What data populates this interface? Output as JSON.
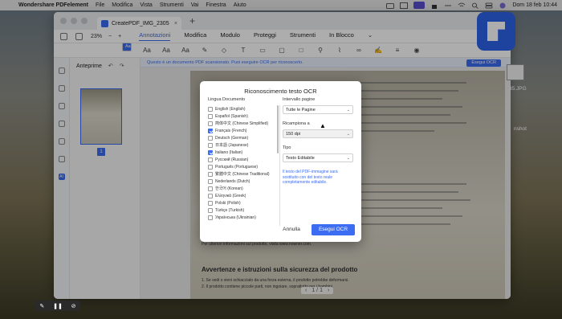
{
  "menubar": {
    "app_name": "Wondershare PDFelement",
    "items": [
      "File",
      "Modifica",
      "Vista",
      "Strumenti",
      "Vai",
      "Finestra",
      "Aiuto"
    ],
    "clock": "Dom 18 feb  10:44"
  },
  "window": {
    "tab_title": "CreatePDF_IMG_2305",
    "zoom": "23%",
    "tabs": [
      "Annotazioni",
      "Modifica",
      "Modulo",
      "Proteggi",
      "Strumenti",
      "In Blocco"
    ],
    "active_tab": "Annotazioni",
    "tab_more": "⌄",
    "tool_labels": [
      "Aa",
      "Aa",
      "Aa",
      "Aa"
    ]
  },
  "sidebar": {
    "panel_title": "Anteprime",
    "page_badge": "1"
  },
  "infobar": {
    "text": "Questo è un documento PDF scansionato. Puoi eseguire OCR per riconoscerlo.",
    "button": "Esegui OCR"
  },
  "document": {
    "heading": "Avvertenze e istruzioni sulla sicurezza del prodotto",
    "lines": [
      "rapidamente. Si prega di scaricare in modo sicuro, seguendo il link per il download.",
      "Per ulteriori informazioni sul prodotto, visita www.nowner.com.",
      "1. Se vedi o vieni schiacciato da una forza esterna, il prodotto potrebbe deformarsi.",
      "2. Il prodotto contiene piccole parti, non ingoiare, soprattutto per i bambini."
    ],
    "pager": "1 / 1"
  },
  "dialog": {
    "title": "Riconoscimento testo OCR",
    "languages_label": "Lingua Documento",
    "languages": [
      {
        "name": "English (English)",
        "checked": false
      },
      {
        "name": "Español (Spanish)",
        "checked": false
      },
      {
        "name": "简体中文 (Chinese Simplified)",
        "checked": false
      },
      {
        "name": "Français (French)",
        "checked": true
      },
      {
        "name": "Deutsch (German)",
        "checked": false
      },
      {
        "name": "日本語 (Japanese)",
        "checked": false
      },
      {
        "name": "Italiano (Italian)",
        "checked": true
      },
      {
        "name": "Русский (Russian)",
        "checked": false
      },
      {
        "name": "Português (Portuguese)",
        "checked": false
      },
      {
        "name": "繁體中文 (Chinese Traditional)",
        "checked": false
      },
      {
        "name": "Nederlands (Dutch)",
        "checked": false
      },
      {
        "name": "한국어 (Korean)",
        "checked": false
      },
      {
        "name": "Ελληνικά (Greek)",
        "checked": false
      },
      {
        "name": "Polski (Polish)",
        "checked": false
      },
      {
        "name": "Türkçe (Turkish)",
        "checked": false
      },
      {
        "name": "Українська (Ukrainian)",
        "checked": false
      }
    ],
    "range_label": "Intervallo pagine",
    "range_value": "Tutte le Pagine",
    "resample_label": "Ricampiona a",
    "resample_value": "150 dpi",
    "type_label": "Tipo",
    "type_value": "Testo Editabile",
    "note": "Il testo del PDF-immagine sarà sostituito con del testo reale completamente editabile.",
    "cancel": "Annulla",
    "ok": "Esegui OCR"
  },
  "desktop": {
    "file_label": "35.JPG",
    "shot_label": "nshot"
  },
  "colors": {
    "accent": "#3b6cf1",
    "brand": "#2c63ea"
  }
}
